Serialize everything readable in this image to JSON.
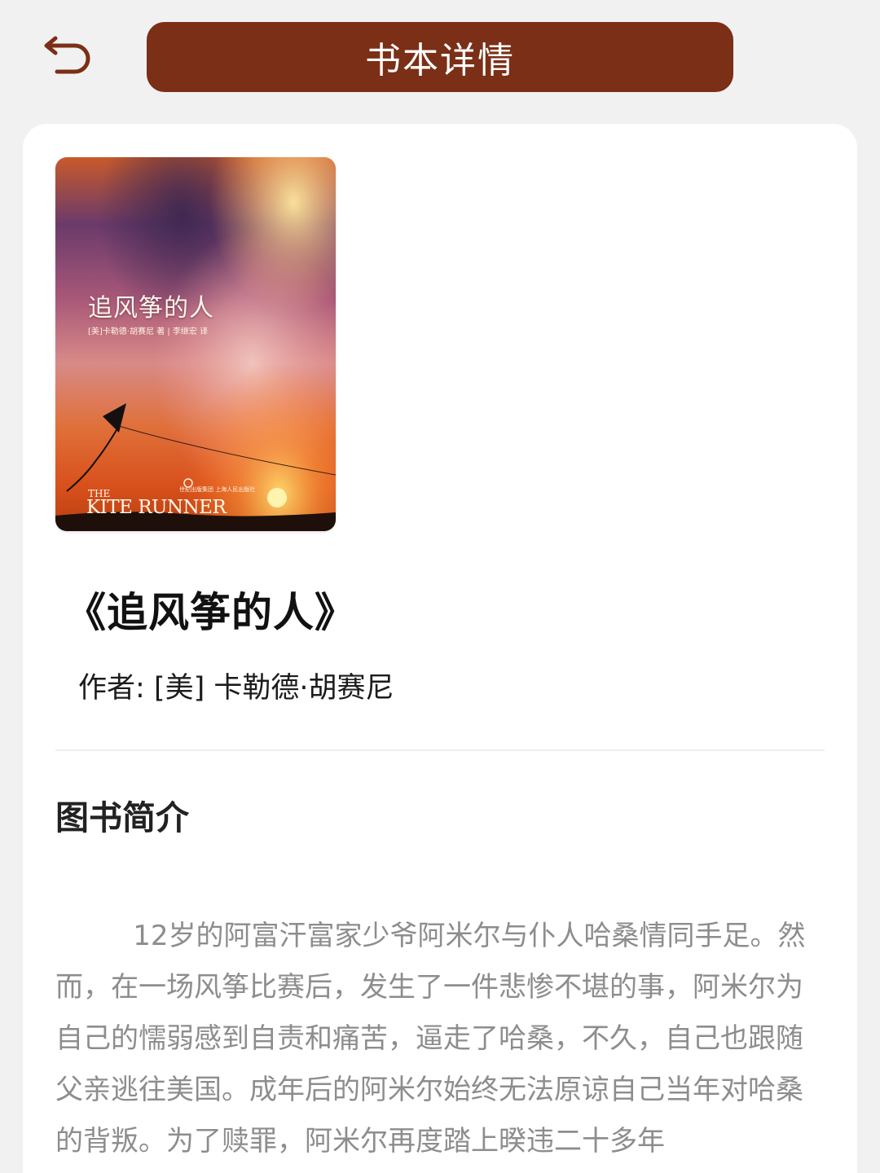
{
  "header": {
    "title": "书本详情",
    "back_icon": "back-arrow-icon",
    "title_bar_color": "#7a2f16"
  },
  "book": {
    "cover": {
      "title_cn": "追风筝的人",
      "credits": "[美]卡勒德·胡赛尼 著 | 李继宏 译",
      "title_en_prefix": "THE",
      "title_en": "KITE RUNNER",
      "publisher": "世纪出版集团 上海人民出版社"
    },
    "title": "《追风筝的人》",
    "author_line": "作者: [美] 卡勒德·胡赛尼"
  },
  "intro": {
    "heading": "图书简介",
    "text": "12岁的阿富汗富家少爷阿米尔与仆人哈桑情同手足。然而，在一场风筝比赛后，发生了一件悲惨不堪的事，阿米尔为自己的懦弱感到自责和痛苦，逼走了哈桑，不久，自己也跟随父亲逃往美国。成年后的阿米尔始终无法原谅自己当年对哈桑的背叛。为了赎罪，阿米尔再度踏上暌违二十多年"
  }
}
